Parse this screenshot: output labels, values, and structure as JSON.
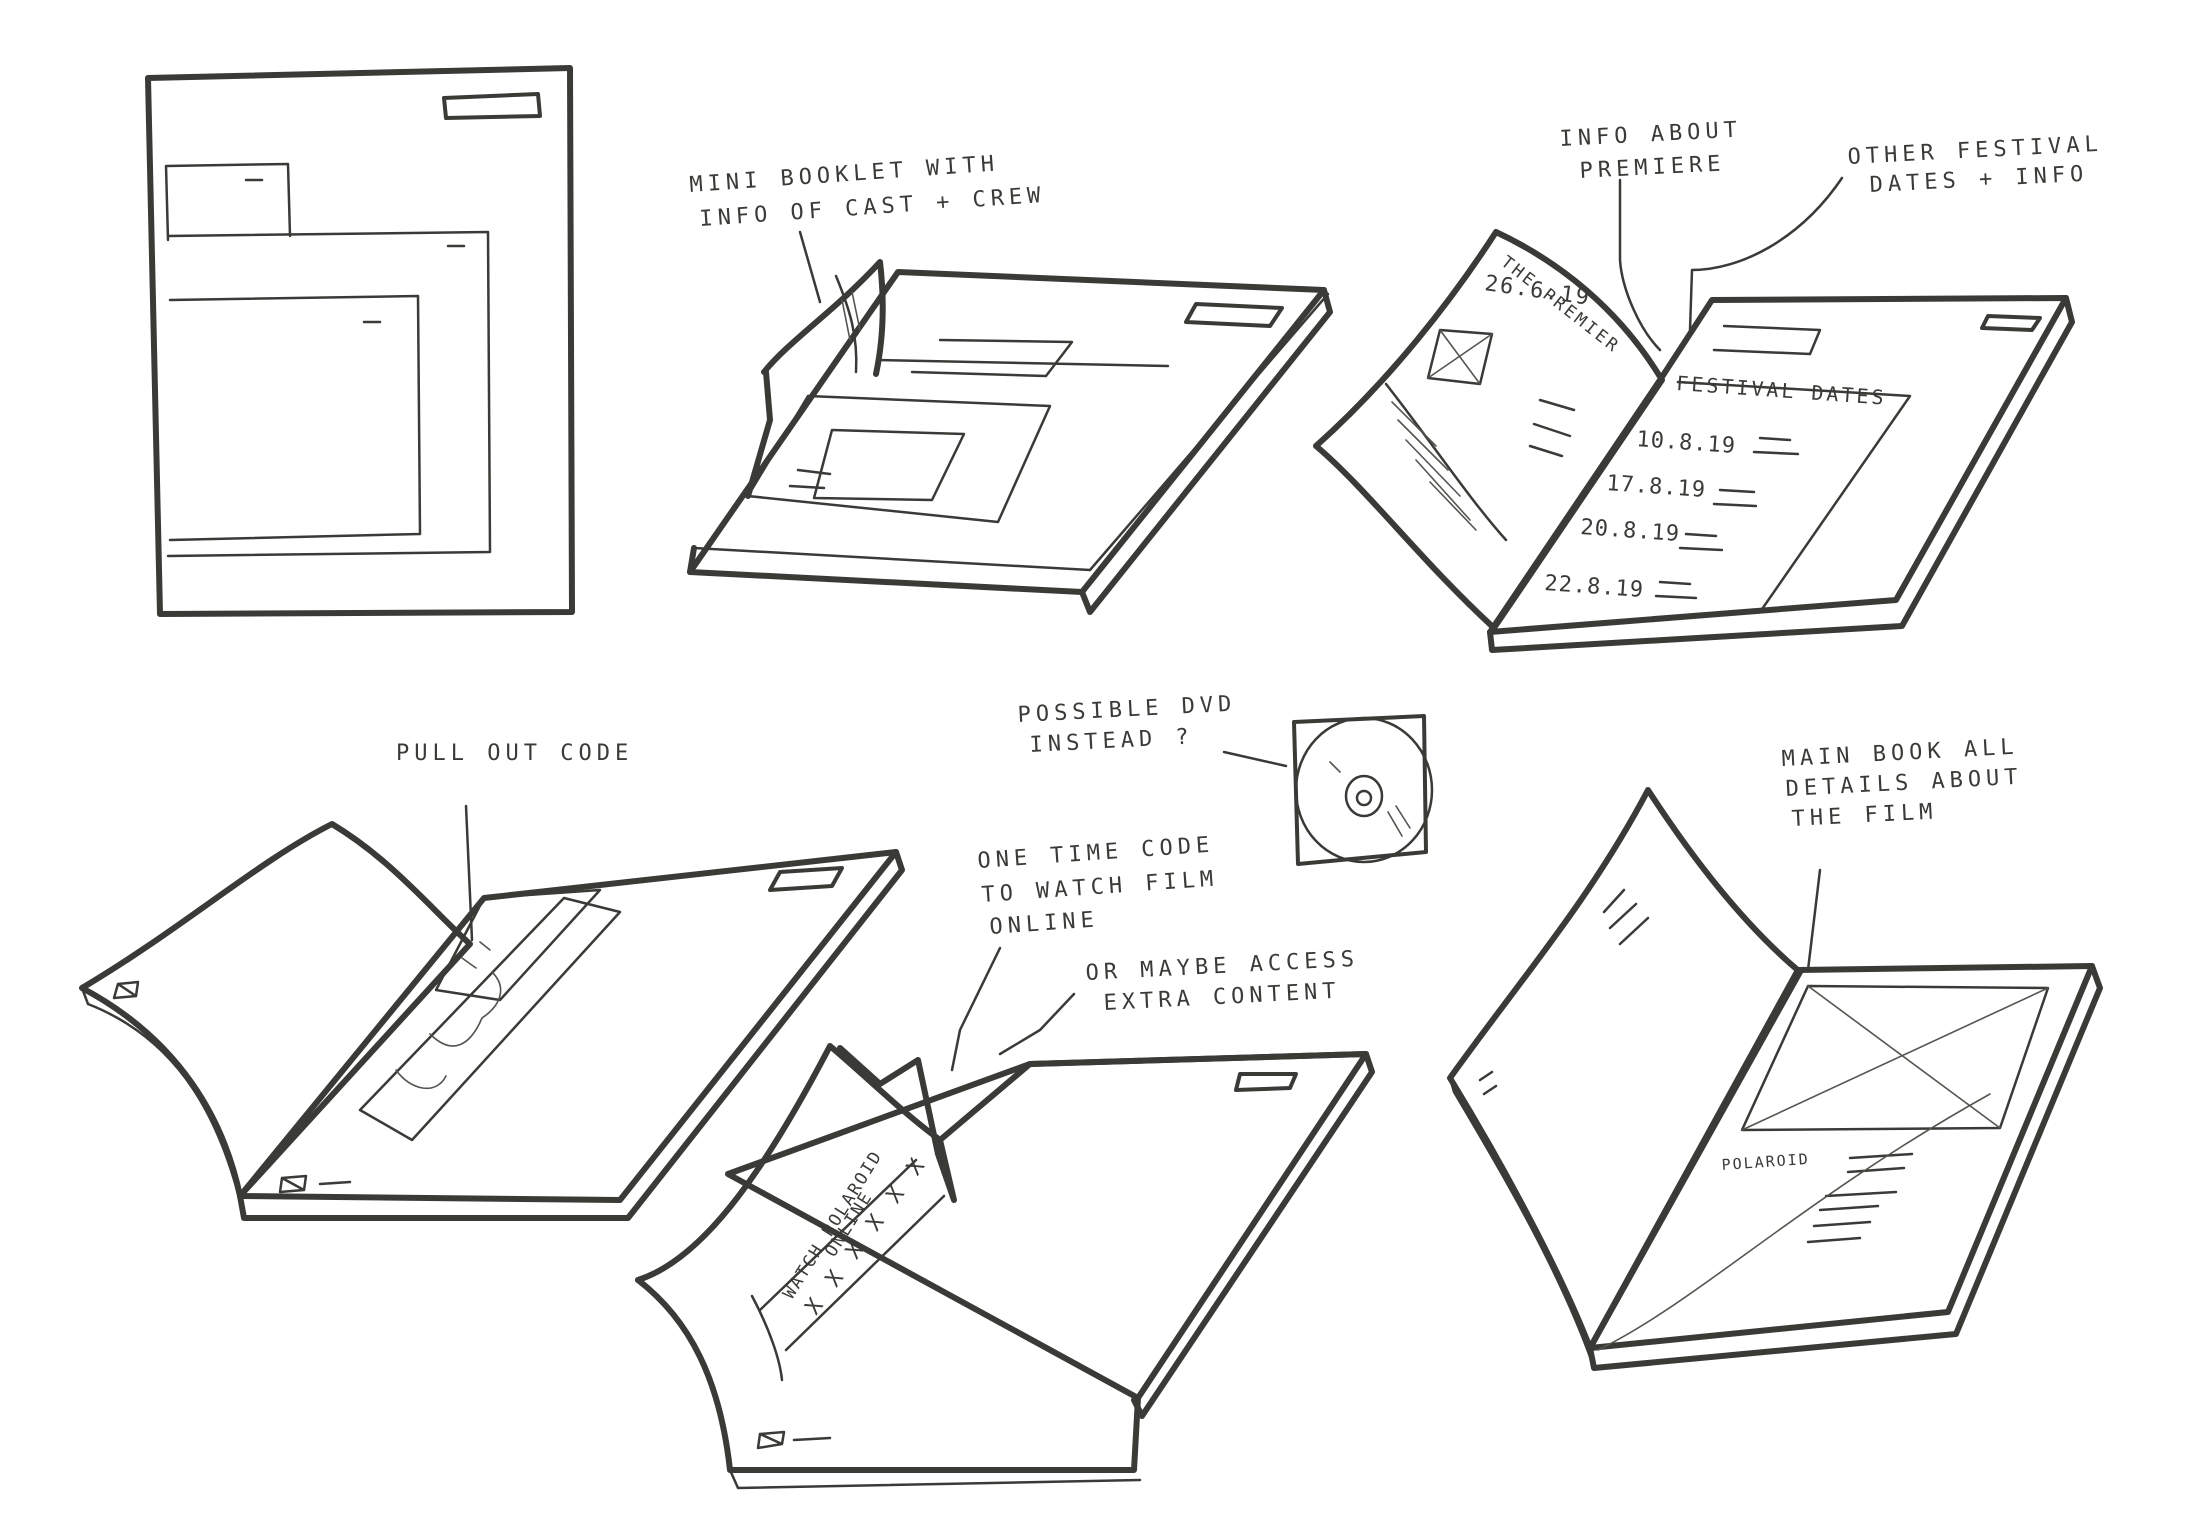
{
  "annotations": {
    "mini_booklet": [
      "MINI BOOKLET WITH",
      "INFO OF CAST + CREW"
    ],
    "info_premiere": [
      "INFO ABOUT",
      "PREMIERE"
    ],
    "other_festival": [
      "OTHER FESTIVAL",
      "DATES + INFO"
    ],
    "pull_out_code": [
      "PULL OUT CODE"
    ],
    "possible_dvd": [
      "POSSIBLE DVD",
      "INSTEAD ?"
    ],
    "one_time_code": [
      "ONE TIME CODE",
      "TO WATCH FILM",
      "ONLINE"
    ],
    "extra_content": [
      "OR MAYBE ACCESS",
      "EXTRA CONTENT"
    ],
    "main_book": [
      "MAIN BOOK ALL",
      "DETAILS ABOUT",
      "THE FILM"
    ]
  },
  "open_book": {
    "left_title": "THE PREMIER",
    "left_date": "26.6.19",
    "right_title": "FESTIVAL DATES",
    "dates": [
      "10.8.19",
      "17.8.19",
      "20.8.19",
      "22.8.19"
    ]
  },
  "code_card": [
    "WATCH POLAROID",
    "ONLINE",
    "X X X X X X"
  ],
  "main_book_label": "POLAROID"
}
